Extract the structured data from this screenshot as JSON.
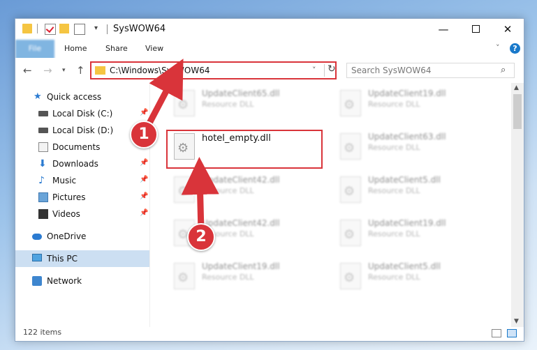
{
  "window": {
    "title": "SysWOW64"
  },
  "ribbon": {
    "tabs": [
      "File",
      "Home",
      "Share",
      "View"
    ],
    "help": "?"
  },
  "address": {
    "path": "C:\\Windows\\SysWOW64"
  },
  "search": {
    "placeholder": "Search SysWOW64"
  },
  "sidebar": {
    "items": [
      {
        "label": "Quick access",
        "icon": "star-icon"
      },
      {
        "label": "Local Disk (C:)",
        "icon": "disk-icon"
      },
      {
        "label": "Local Disk (D:)",
        "icon": "disk-icon"
      },
      {
        "label": "Documents",
        "icon": "documents-icon"
      },
      {
        "label": "Downloads",
        "icon": "downloads-icon"
      },
      {
        "label": "Music",
        "icon": "music-icon"
      },
      {
        "label": "Pictures",
        "icon": "pictures-icon"
      },
      {
        "label": "Videos",
        "icon": "videos-icon"
      },
      {
        "label": "OneDrive",
        "icon": "cloud-icon"
      },
      {
        "label": "This PC",
        "icon": "pc-icon"
      },
      {
        "label": "Network",
        "icon": "network-icon"
      }
    ]
  },
  "files": [
    {
      "name": "UpdateClient65.dll",
      "type": "Resource DLL"
    },
    {
      "name": "UpdateClient19.dll",
      "type": "Resource DLL"
    },
    {
      "name": "hotel_empty.dll",
      "type": ""
    },
    {
      "name": "UpdateClient63.dll",
      "type": "Resource DLL"
    },
    {
      "name": "UpdateClient42.dll",
      "type": "Resource DLL"
    },
    {
      "name": "UpdateClient5.dll",
      "type": "Resource DLL"
    },
    {
      "name": "UpdateClient42.dll",
      "type": "Resource DLL"
    },
    {
      "name": "UpdateClient19.dll",
      "type": "Resource DLL"
    },
    {
      "name": "UpdateClient19.dll",
      "type": "Resource DLL"
    },
    {
      "name": "UpdateClient5.dll",
      "type": "Resource DLL"
    }
  ],
  "status": {
    "item_count": "122 items"
  },
  "annotations": {
    "step1": "1",
    "step2": "2",
    "color": "#d9343a"
  }
}
